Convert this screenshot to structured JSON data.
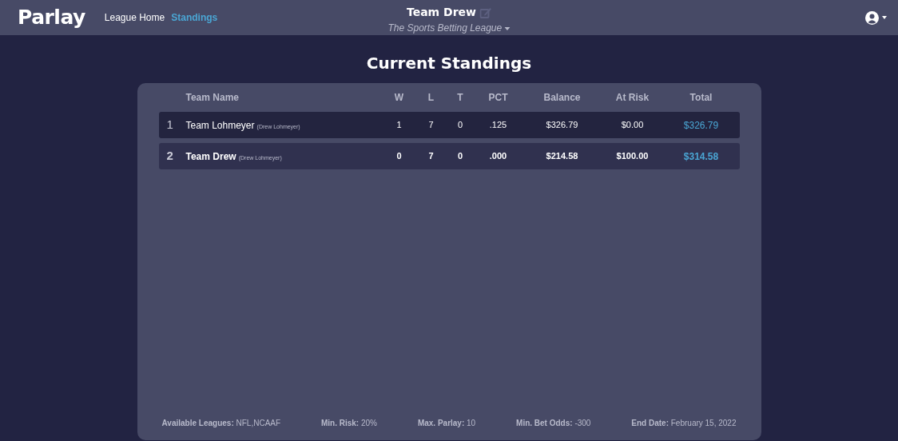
{
  "navbar": {
    "brand": "Parlay",
    "links": [
      {
        "label": "League Home",
        "selected": false
      },
      {
        "label": "Standings",
        "selected": true
      }
    ],
    "team_name": "Team Drew",
    "league": "The Sports Betting League"
  },
  "page_title": "Current Standings",
  "table": {
    "columns": [
      "Team Name",
      "W",
      "L",
      "T",
      "PCT",
      "Balance",
      "At Risk",
      "Total"
    ],
    "rows": [
      {
        "rank": "1",
        "team": "Team Lohmeyer",
        "owner": "(Drew Lohmeyer)",
        "w": "1",
        "l": "7",
        "t": "0",
        "pct": ".125",
        "balance": "$326.79",
        "at_risk": "$0.00",
        "total": "$326.79",
        "selected": false
      },
      {
        "rank": "2",
        "team": "Team Drew",
        "owner": "(Drew Lohmeyer)",
        "w": "0",
        "l": "7",
        "t": "0",
        "pct": ".000",
        "balance": "$214.58",
        "at_risk": "$100.00",
        "total": "$314.58",
        "selected": true
      }
    ]
  },
  "footer": [
    "**Available Leagues:** NFL,NCAAF",
    "**Min. Risk:** 20%",
    "**Max. Parlay:** 10",
    "**Min. Bet Odds:** -300",
    "**End Date:** February 15, 2022"
  ]
}
